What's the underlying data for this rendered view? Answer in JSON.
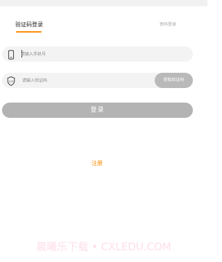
{
  "tabs": {
    "sms_login": "验证码登录",
    "password_login": "密码登录"
  },
  "phone_field": {
    "placeholder": "请输入手机号",
    "value": ""
  },
  "code_field": {
    "placeholder": "请输入验证码",
    "value": "",
    "get_code_label": "获取验证码"
  },
  "login_button": {
    "label": "登录"
  },
  "register_link": {
    "label": "注册"
  },
  "watermark": {
    "text": "晨曦乐下载 • CXLEDU.COM"
  },
  "icons": {
    "phone": "phone-icon",
    "code": "shield-code-icon"
  },
  "colors": {
    "accent": "#ff8a00",
    "button_disabled": "#b3b3b3",
    "input_background": "#f3f3f3",
    "tab_inactive": "#a9a9a9"
  }
}
